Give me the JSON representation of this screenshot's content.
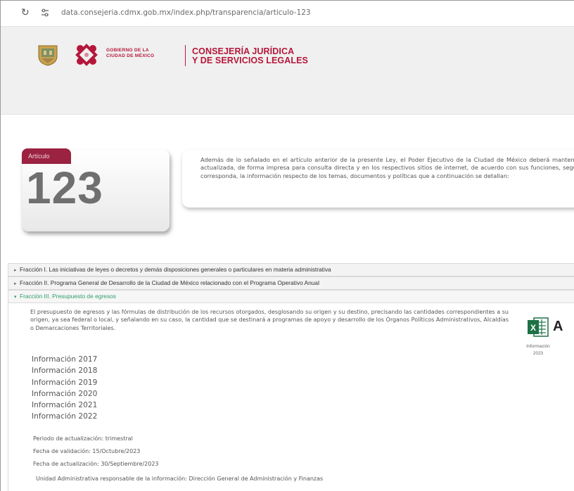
{
  "browser": {
    "url": "data.consejeria.cdmx.gob.mx/index.php/transparencia/articulo-123"
  },
  "header": {
    "gov_line1": "GOBIERNO DE LA",
    "gov_line2": "CIUDAD DE MÉXICO",
    "consejeria_line1": "CONSEJERÍA JURÍDICA",
    "consejeria_line2": "Y DE SERVICIOS LEGALES"
  },
  "article": {
    "tab_label": "Artículo",
    "number": "123",
    "text": "Además de lo señalado en el artículo anterior de la presente Ley, el Poder Ejecutivo de la Ciudad de México deberá mantener actualizada, de forma impresa para consulta directa y en los respectivos sitios de internet, de acuerdo con sus funciones, según corresponda, la información respecto de los temas, documentos y políticas que a continuación se detallan:"
  },
  "accordion": {
    "items": [
      {
        "label": "Fracción I. Las iniciativas de leyes o decretos y demás disposiciones generales o particulares en materia administrativa"
      },
      {
        "label": "Fracción II. Programa General de Desarrollo de la Ciudad de México relacionado con el Programa Operativo Anual"
      },
      {
        "label": "Fracción III. Presupuesto de egresos"
      }
    ]
  },
  "panel": {
    "description": "El presupuesto de egresos y las fórmulas de distribución de los recursos otorgados, desglosando su origen y su destino, precisando las cantidades correspondientes a su origen, ya sea federal o local, y señalando en su caso, la cantidad que se destinará a programas de apoyo y desarrollo de los Órganos Políticos Administrativos, Alcaldías o Demarcaciones Territoriales.",
    "links": [
      "Información 2017",
      "Información 2018",
      "Información 2019",
      "Información 2020",
      "Información 2021",
      "Información 2022"
    ],
    "periodo": "Periodo de actualización: trimestral",
    "validacion": "Fecha de validación: 15/Octubre/2023",
    "actualizacion": "Fecha de actualización: 30/Septiembre/2023",
    "unidad": "Unidad Administrativa responsable de la información: Dirección General de Administración y Finanzas",
    "excel_letter": "A",
    "excel_caption1": "Información",
    "excel_caption2": "2023",
    "excel_icon": "excel-file-icon",
    "excel_color": "#1e7145"
  },
  "colors": {
    "brand": "#b5173a",
    "article_tab": "#9b2240",
    "active_fraction": "#2e9e6b"
  }
}
